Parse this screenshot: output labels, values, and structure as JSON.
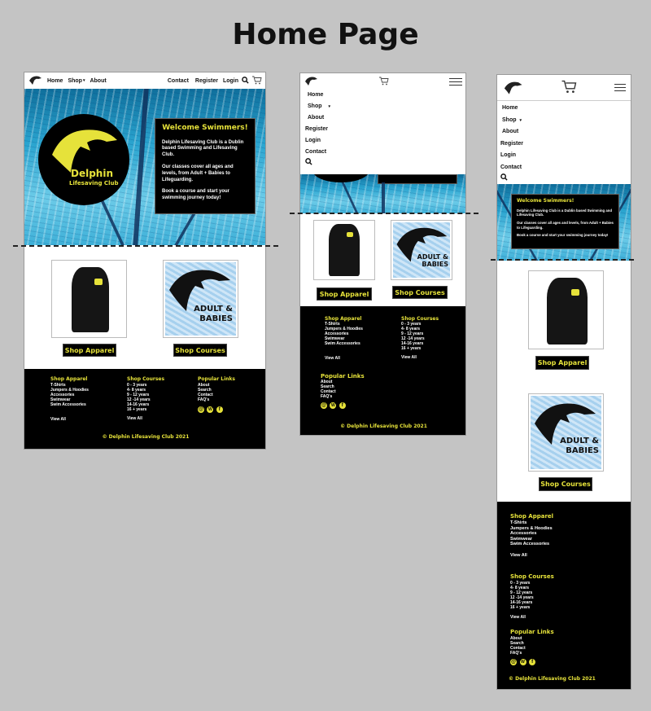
{
  "page_title": "Home Page",
  "brand": {
    "name_line1": "Delphin",
    "name_line2": "Lifesaving Club",
    "accent": "#e6e23a",
    "dark": "#000000"
  },
  "nav": {
    "left": [
      "Home",
      "Shop",
      "About"
    ],
    "right": [
      "Contact",
      "Register",
      "Login"
    ],
    "mobile": [
      "Home",
      "Shop",
      "About",
      "Register",
      "Login",
      "Contact"
    ],
    "icons": [
      "logo",
      "search-icon",
      "cart-icon",
      "hamburger-icon"
    ]
  },
  "hero": {
    "heading": "Welcome Swimmers!",
    "p1": "Delphin Lifesaving Club is a Dublin based Swimming and Lifesaving Club.",
    "p2": "Our classes cover all ages and levels, from Adult + Babies to Lifeguarding.",
    "p3": "Book a course and start your swimming journey today!"
  },
  "products": {
    "apparel_button": "Shop Apparel",
    "courses_button": "Shop Courses",
    "courses_image_text1": "ADULT &",
    "courses_image_text2": "BABIES"
  },
  "footer": {
    "apparel": {
      "heading": "Shop Apparel",
      "items": [
        "T-Shirts",
        "Jumpers & Hoodies",
        "Accessories",
        "Swimwear",
        "Swim Accessories"
      ],
      "view_all": "View All"
    },
    "courses": {
      "heading": "Shop Courses",
      "items": [
        "0 - 3 years",
        "4- 8 years",
        "9 - 12 years",
        "12 -14 years",
        "14-16 years",
        "16 + years"
      ],
      "view_all": "View All"
    },
    "popular": {
      "heading": "Popular Links",
      "items": [
        "About",
        "Search",
        "Contact",
        "FAQ's"
      ]
    },
    "social": [
      "@",
      "W",
      "f"
    ],
    "copyright": "© Delphin Lifesaving Club 2021"
  }
}
